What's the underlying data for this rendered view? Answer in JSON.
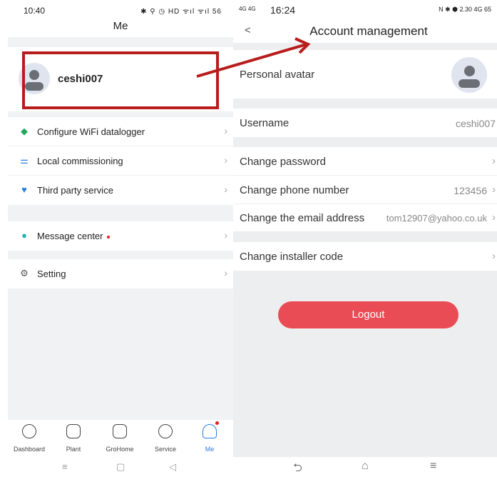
{
  "left": {
    "status_time": "10:40",
    "status_icons": "✱ ⚲ ◷ HD ᯤıl ᯤıl 56",
    "title": "Me",
    "username": "ceshi007",
    "group1": [
      {
        "label": "Configure WiFi datalogger",
        "icon": "datalogger-icon",
        "color": "#25a55f"
      },
      {
        "label": "Local commissioning",
        "icon": "commissioning-icon",
        "color": "#2a7de1"
      },
      {
        "label": "Third party service",
        "icon": "third-party-icon",
        "color": "#2a7de1"
      }
    ],
    "message_label": "Message center",
    "setting_label": "Setting",
    "tabs": [
      "Dashboard",
      "Plant",
      "GroHome",
      "Service",
      "Me"
    ],
    "nav_keys": [
      "≡",
      "▢",
      "◁"
    ]
  },
  "right": {
    "status_time": "16:24",
    "status_net": "4G 4G",
    "status_icons": "N ✱ ⬢ 2.30 4G 65",
    "title": "Account management",
    "back": "<",
    "avatar_label": "Personal avatar",
    "username_label": "Username",
    "username_value": "ceshi007",
    "change_password": "Change password",
    "change_phone": "Change phone number",
    "phone_value": "123456",
    "change_email": "Change the email address",
    "email_value": "tom12907@yahoo.co.uk",
    "change_installer": "Change installer code",
    "logout": "Logout",
    "nav_keys": [
      "⮌",
      "⌂",
      "≡"
    ]
  },
  "colors": {
    "highlight": "#b81c1c",
    "logout": "#ea4c55",
    "active_tab": "#2a7de1"
  }
}
